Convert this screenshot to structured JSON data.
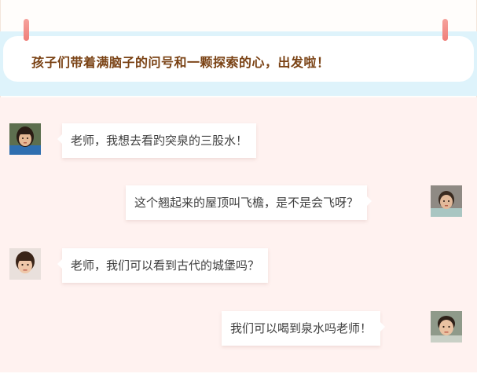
{
  "banner": {
    "text": "孩子们带着满脑子的问号和一颗探索的心，出发啦！"
  },
  "messages": [
    {
      "side": "left",
      "avatar": "girl-avatar",
      "text": "老师，我想去看趵突泉的三股水！"
    },
    {
      "side": "right",
      "avatar": "boy-avatar",
      "text": "这个翘起来的屋顶叫飞檐，是不是会飞呀？"
    },
    {
      "side": "left",
      "avatar": "girl-avatar",
      "text": "老师，我们可以看到古代的城堡吗？"
    },
    {
      "side": "right",
      "avatar": "boy-avatar",
      "text": "我们可以喝到泉水吗老师！"
    }
  ],
  "colors": {
    "banner_band": "#def3fb",
    "banner_text": "#7a4214",
    "chat_bg": "#fff2f0",
    "pin": "#ef7f7a"
  }
}
